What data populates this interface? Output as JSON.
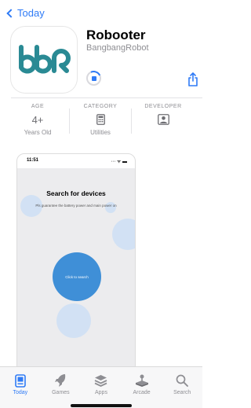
{
  "nav": {
    "back_label": "Today"
  },
  "app": {
    "name": "Robooter",
    "developer": "BangbangRobot",
    "logo_text": "bbR",
    "download_progress": 0.15
  },
  "info": {
    "age": {
      "label": "AGE",
      "value": "4+",
      "sub": "Years Old"
    },
    "category": {
      "label": "CATEGORY",
      "icon": "calculator-icon",
      "sub": "Utilities"
    },
    "developer": {
      "label": "DEVELOPER",
      "icon": "person-icon"
    }
  },
  "screenshot": {
    "time": "11:51",
    "title": "Search for devices",
    "subtitle": "Pls guarantee the battery power and main power on",
    "button_label": "Click to search"
  },
  "tabs": [
    {
      "label": "Today",
      "icon": "today-icon",
      "active": true
    },
    {
      "label": "Games",
      "icon": "rocket-icon",
      "active": false
    },
    {
      "label": "Apps",
      "icon": "apps-stack-icon",
      "active": false
    },
    {
      "label": "Arcade",
      "icon": "joystick-icon",
      "active": false
    },
    {
      "label": "Search",
      "icon": "search-icon",
      "active": false
    }
  ],
  "colors": {
    "accent": "#2f7bf6",
    "logo_teal": "#2a8a94",
    "search_button": "#3f8fd7"
  }
}
